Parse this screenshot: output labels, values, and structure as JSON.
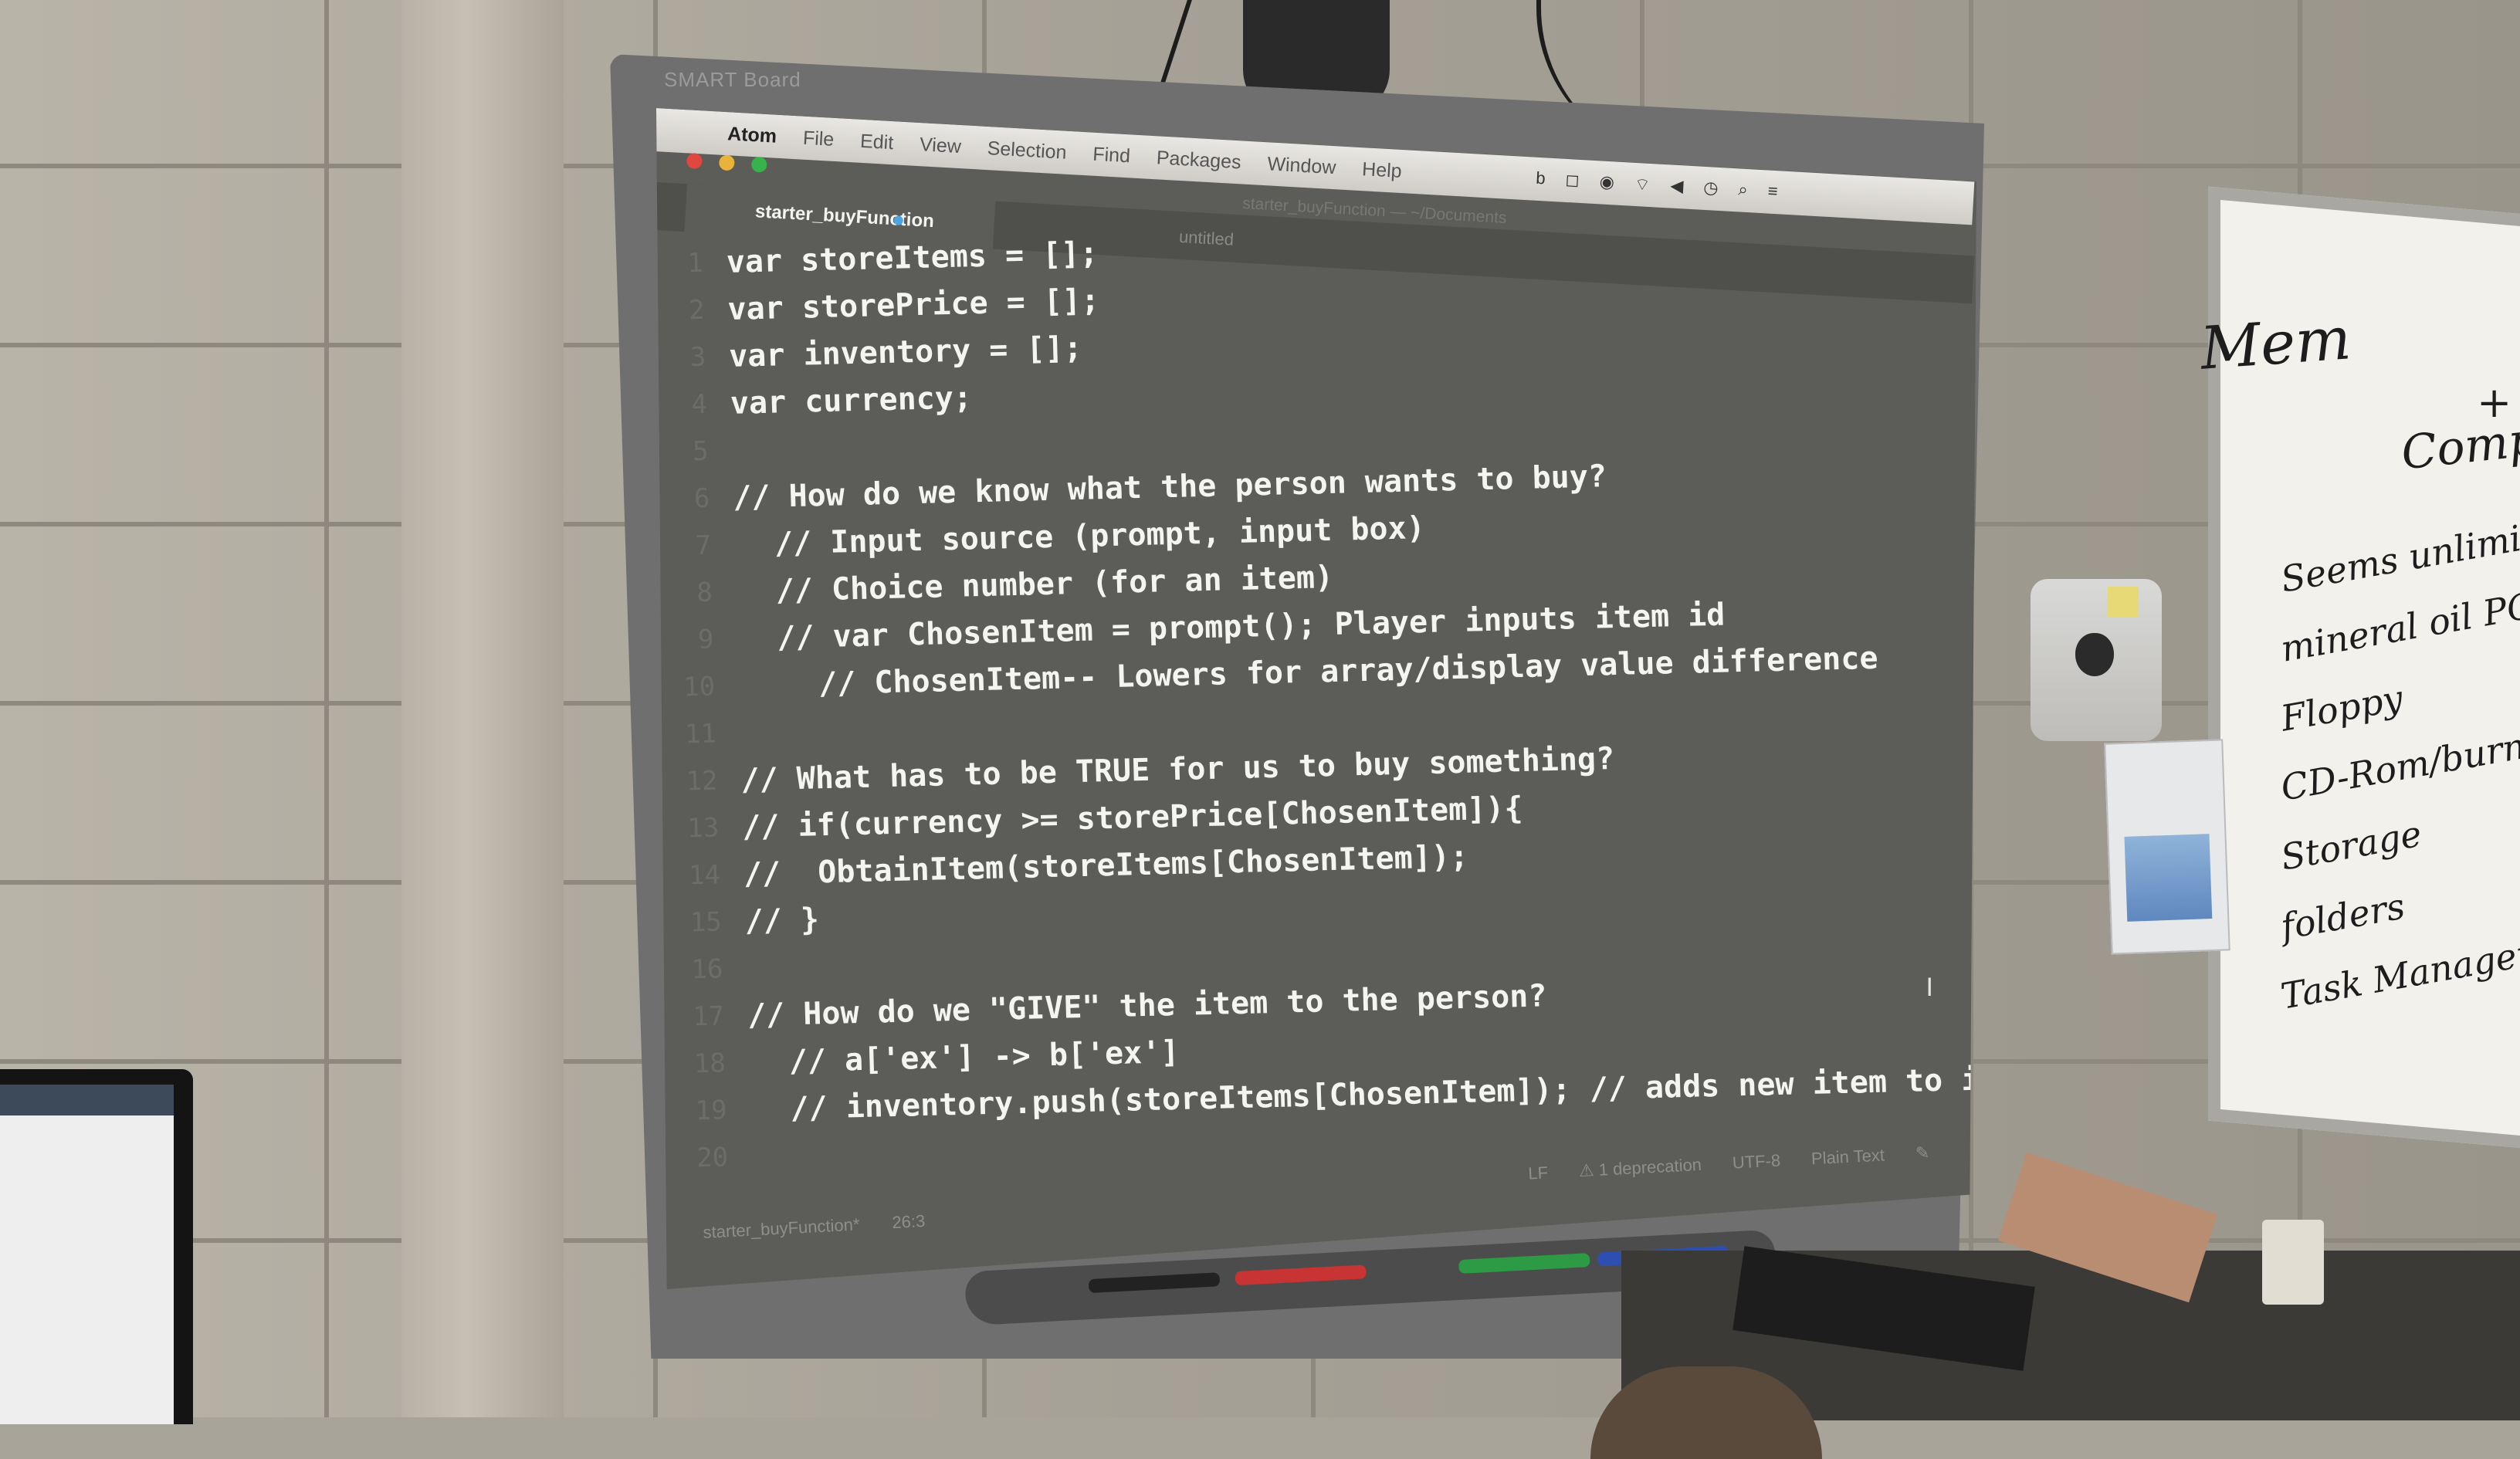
{
  "board_brand": "SMART Board",
  "menubar": {
    "app_name": "Atom",
    "items": [
      "File",
      "Edit",
      "View",
      "Selection",
      "Find",
      "Packages",
      "Window",
      "Help"
    ]
  },
  "window_title": "starter_buyFunction — ~/Documents",
  "tabs": {
    "active": "starter_buyFunction",
    "inactive": "untitled"
  },
  "code_lines": [
    {
      "n": "1",
      "text": "var storeItems = [];",
      "indent": 0
    },
    {
      "n": "2",
      "text": "var storePrice = [];",
      "indent": 0
    },
    {
      "n": "3",
      "text": "var inventory = [];",
      "indent": 0
    },
    {
      "n": "4",
      "text": "var currency;",
      "indent": 0
    },
    {
      "n": "5",
      "text": "",
      "indent": 0
    },
    {
      "n": "6",
      "text": "// How do we know what the person wants to buy?",
      "indent": 0
    },
    {
      "n": "7",
      "text": "// Input source (prompt, input box)",
      "indent": 1
    },
    {
      "n": "8",
      "text": "// Choice number (for an item)",
      "indent": 1
    },
    {
      "n": "9",
      "text": "// var ChosenItem = prompt(); Player inputs item id",
      "indent": 1
    },
    {
      "n": "10",
      "text": "// ChosenItem-- Lowers for array/display value difference",
      "indent": 2
    },
    {
      "n": "11",
      "text": "",
      "indent": 0
    },
    {
      "n": "12",
      "text": "// What has to be TRUE for us to buy something?",
      "indent": 0
    },
    {
      "n": "13",
      "text": "// if(currency >= storePrice[ChosenItem]){",
      "indent": 0
    },
    {
      "n": "14",
      "text": "//  ObtainItem(storeItems[ChosenItem]);",
      "indent": 0
    },
    {
      "n": "15",
      "text": "// }",
      "indent": 0
    },
    {
      "n": "16",
      "text": "",
      "indent": 0
    },
    {
      "n": "17",
      "text": "// How do we \"GIVE\" the item to the person?",
      "indent": 0
    },
    {
      "n": "18",
      "text": "// a['ex'] -> b['ex']",
      "indent": 1
    },
    {
      "n": "19",
      "text": "// inventory.push(storeItems[ChosenItem]); // adds new item to invent",
      "indent": 1
    },
    {
      "n": "20",
      "text": "",
      "indent": 0
    }
  ],
  "statusbar": {
    "file": "starter_buyFunction*",
    "cursor": "26:3",
    "line_ending": "LF",
    "deprecation": "1 deprecation",
    "encoding": "UTF-8",
    "grammar": "Plain Text"
  },
  "whiteboard": {
    "title_1": "Mem",
    "amp": "+",
    "title_2": "Comput",
    "list": [
      "Seems unlimited",
      "mineral oil PC",
      "Floppy",
      "CD-Rom/burner",
      "Storage",
      "folders",
      "Task Manager"
    ]
  },
  "colors": {
    "editor_bg": "#5c5d59",
    "code_text": "#f4f4f0",
    "tab_modified": "#4ea4e0"
  }
}
